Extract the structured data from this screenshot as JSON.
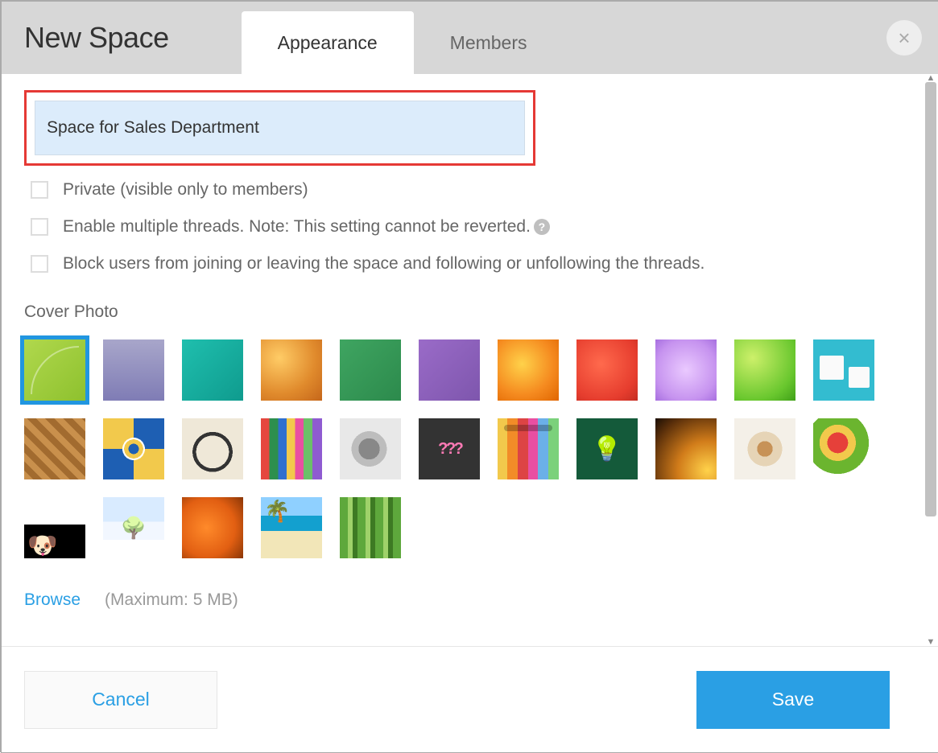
{
  "dialog": {
    "title": "New Space",
    "close_glyph": "×"
  },
  "tabs": {
    "appearance": "Appearance",
    "members": "Members"
  },
  "form": {
    "space_name": "Space for Sales Department",
    "checkboxes": {
      "private": "Private (visible only to members)",
      "multithread": "Enable multiple threads. Note: This setting cannot be reverted.",
      "block_join": "Block users from joining or leaving the space and following or unfollowing the threads."
    },
    "help_glyph": "?"
  },
  "cover": {
    "label": "Cover Photo",
    "browse": "Browse",
    "max_hint": "(Maximum: 5 MB)"
  },
  "footer": {
    "cancel": "Cancel",
    "save": "Save"
  }
}
